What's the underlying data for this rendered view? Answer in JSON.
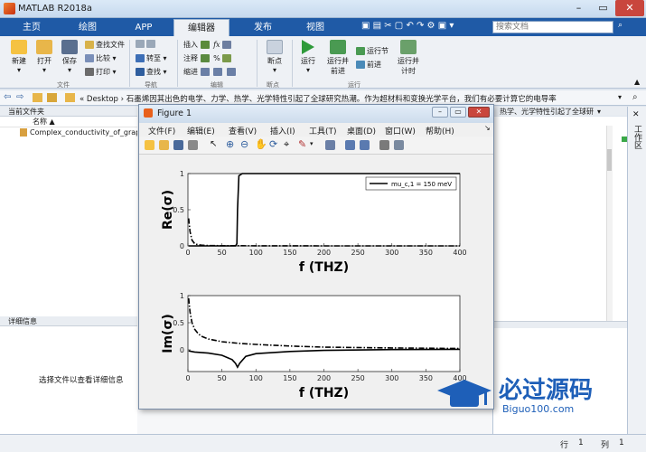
{
  "app": {
    "title": "MATLAB R2018a"
  },
  "tabs": [
    "主页",
    "绘图",
    "APP",
    "编辑器",
    "发布",
    "视图"
  ],
  "active_tab": "编辑器",
  "search": {
    "placeholder": "搜索文档"
  },
  "ribbon": {
    "file": {
      "new": "新建",
      "open": "打开",
      "save": "保存",
      "find_files": "查找文件",
      "compare": "比较",
      "print": "打印",
      "group": "文件"
    },
    "nav": {
      "goto": "转至",
      "find": "查找",
      "group": "导航"
    },
    "edit": {
      "insert": "插入",
      "comment": "注释",
      "indent": "缩进",
      "group": "编辑"
    },
    "breakpoints": {
      "label": "断点",
      "group": "断点"
    },
    "run": {
      "run": "运行",
      "run_advance": "运行并\n前进",
      "run_section": "运行节",
      "advance": "前进",
      "run_time": "运行并\n计时",
      "group": "运行"
    }
  },
  "address": {
    "path": "« Desktop › 石墨烯因其出色的电学、力学、热学、光学特性引起了全球研究热潮。作为超材料和变换光学平台，我们有必要计算它的电导率"
  },
  "left_panel": {
    "header": "当前文件夹",
    "column": "名称",
    "file": "Complex_conductivity_of_grap",
    "details_header": "详细信息",
    "details_text": "选择文件以查看详细信息"
  },
  "editor_tab_fragment": "热学、光学特性引起了全球研",
  "right_panel": {
    "vertical_label": "工作区"
  },
  "status": {
    "row_label": "行",
    "row": "1",
    "col_label": "列",
    "col": "1"
  },
  "figure": {
    "title": "Figure 1",
    "menus": [
      "文件(F)",
      "编辑(E)",
      "查看(V)",
      "插入(I)",
      "工具(T)",
      "桌面(D)",
      "窗口(W)",
      "帮助(H)"
    ]
  },
  "watermark": {
    "text": "必过源码",
    "url": "Biguo100.com"
  },
  "colors": {
    "ribbon_tab_bar": "#1f5aa6",
    "matlab_logo": "#e8601c"
  },
  "chart_data": [
    {
      "type": "line",
      "xlabel": "f (THZ)",
      "ylabel": "Re(σ)",
      "xlim": [
        0,
        400
      ],
      "ylim": [
        0,
        1
      ],
      "xticks": [
        0,
        50,
        100,
        150,
        200,
        250,
        300,
        350,
        400
      ],
      "yticks": [
        0,
        0.5,
        1
      ],
      "legend": {
        "label": "mu_c,1 = 150 meV",
        "position": "top-right"
      },
      "series": [
        {
          "style": "solid",
          "x": [
            1,
            60,
            70,
            72,
            73,
            75,
            80,
            100,
            200,
            300,
            400
          ],
          "y": [
            0,
            0,
            0,
            0.03,
            0.5,
            0.97,
            1,
            1,
            1,
            1,
            1
          ]
        },
        {
          "style": "dashdot",
          "x": [
            1,
            3,
            6,
            10,
            15,
            20,
            30,
            50,
            100,
            200,
            400
          ],
          "y": [
            0.38,
            0.2,
            0.08,
            0.03,
            0.015,
            0.01,
            0.005,
            0.003,
            0.001,
            0,
            0
          ]
        }
      ]
    },
    {
      "type": "line",
      "xlabel": "f (THZ)",
      "ylabel": "Im(σ)",
      "xlim": [
        0,
        400
      ],
      "ylim": [
        -0.4,
        1
      ],
      "xticks": [
        0,
        50,
        100,
        150,
        200,
        250,
        300,
        350,
        400
      ],
      "yticks": [
        0,
        0.5,
        1
      ],
      "series": [
        {
          "style": "dashdot",
          "x": [
            1,
            3,
            6,
            10,
            15,
            20,
            30,
            50,
            75,
            100,
            150,
            200,
            300,
            400
          ],
          "y": [
            0.95,
            0.7,
            0.5,
            0.38,
            0.3,
            0.25,
            0.2,
            0.15,
            0.12,
            0.1,
            0.07,
            0.05,
            0.035,
            0.025
          ]
        },
        {
          "style": "solid",
          "x": [
            1,
            10,
            30,
            50,
            65,
            70,
            73,
            76,
            85,
            100,
            150,
            200,
            300,
            400
          ],
          "y": [
            -0.02,
            -0.04,
            -0.06,
            -0.1,
            -0.18,
            -0.25,
            -0.32,
            -0.25,
            -0.12,
            -0.07,
            -0.03,
            -0.01,
            0.005,
            0.01
          ]
        }
      ]
    }
  ]
}
